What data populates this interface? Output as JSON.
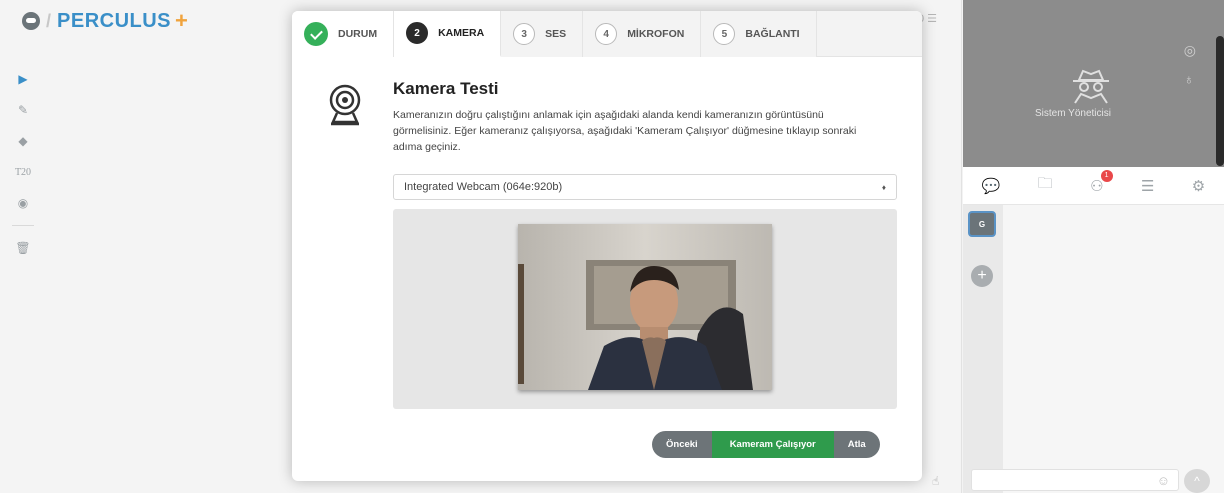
{
  "app": {
    "logo_text": "PERCULUS",
    "logo_plus": "+",
    "logo_separator": "/"
  },
  "toolbar": {
    "tools": [
      {
        "name": "pointer-tool",
        "icon": "cursor-icon",
        "glyph": "▶",
        "active": true
      },
      {
        "name": "pen-tool",
        "icon": "pencil-icon",
        "glyph": "✎",
        "active": false
      },
      {
        "name": "eraser-tool",
        "icon": "eraser-icon",
        "glyph": "◆",
        "active": false
      },
      {
        "name": "text-tool",
        "icon": "text-icon",
        "glyph": "T20",
        "active": false
      },
      {
        "name": "record-tool",
        "icon": "record-icon",
        "glyph": "◉",
        "active": false
      },
      {
        "name": "delete-tool",
        "icon": "trash-icon",
        "glyph": "🗑",
        "active": false
      }
    ],
    "top_mini": "0  ☰",
    "hand_glyph": "☝"
  },
  "right_panel": {
    "user_label": "Sistem Yöneticisi",
    "chip_letter": "G",
    "add_glyph": "+",
    "badge_count": "1",
    "emoji_glyph": "☺",
    "send_glyph": "^",
    "tabs": [
      {
        "name": "chat-tab",
        "icon": "chat-icon",
        "glyph": "💬",
        "active": true
      },
      {
        "name": "files-tab",
        "icon": "folder-icon",
        "glyph": "🗀",
        "active": false
      },
      {
        "name": "participants-tab",
        "icon": "users-icon",
        "glyph": "⚇",
        "active": false
      },
      {
        "name": "list-tab",
        "icon": "list-icon",
        "glyph": "☰",
        "active": false
      },
      {
        "name": "settings-tab",
        "icon": "gear-icon",
        "glyph": "⚙",
        "active": false
      }
    ]
  },
  "modal": {
    "steps": [
      {
        "num": "",
        "label": "DURUM",
        "state": "done"
      },
      {
        "num": "2",
        "label": "KAMERA",
        "state": "active"
      },
      {
        "num": "3",
        "label": "SES",
        "state": "todo"
      },
      {
        "num": "4",
        "label": "MİKROFON",
        "state": "todo"
      },
      {
        "num": "5",
        "label": "BAĞLANTI",
        "state": "todo"
      }
    ],
    "title": "Kamera Testi",
    "description": "Kameranızın doğru çalıştığını anlamak için aşağıdaki alanda kendi kameranızın görüntüsünü görmelisiniz. Eğer kameranız çalışıyorsa, aşağıdaki 'Kameram Çalışıyor' düğmesine tıklayıp sonraki adıma geçiniz.",
    "camera_select": {
      "value": "Integrated Webcam (064e:920b)",
      "caret": "♦"
    },
    "buttons": {
      "prev": "Önceki",
      "ok": "Kameram Çalışıyor",
      "skip": "Atla"
    }
  },
  "colors": {
    "accent_blue": "#3a8fc8",
    "accent_orange": "#f0a33c",
    "success_green": "#2f9b4c",
    "check_green": "#35b05a",
    "button_gray": "#6d7478",
    "badge_red": "#e9484a"
  }
}
